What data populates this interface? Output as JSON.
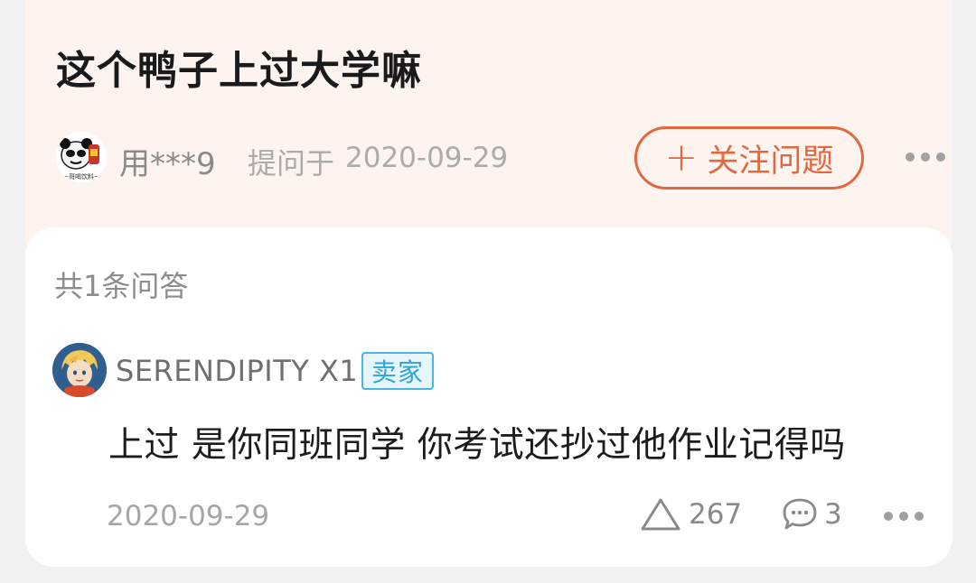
{
  "question": {
    "title": "这个鸭子上过大学嘛",
    "asker_name": "用***9",
    "asked_prefix": "提问于",
    "asked_date": "2020-09-29",
    "avatar_caption": "~哥喝饮料~",
    "follow_label": "关注问题",
    "follow_plus": "+"
  },
  "answers": {
    "count_label": "共1条问答",
    "items": [
      {
        "user_name": "SERENDIPITY X1",
        "badge": "卖家",
        "text": "上过 是你同班同学 你考试还抄过他作业记得吗",
        "date": "2020-09-29",
        "likes": "267",
        "comments": "3"
      }
    ]
  },
  "colors": {
    "accent": "#e2693f",
    "badge": "#4bb4e6",
    "question_bg": "#fdf3ef",
    "page_bg": "#f1f1f3"
  },
  "icons": {
    "plus": "plus-icon",
    "more": "more-dots-icon",
    "like": "triangle-like-icon",
    "comment": "speech-bubble-icon"
  }
}
